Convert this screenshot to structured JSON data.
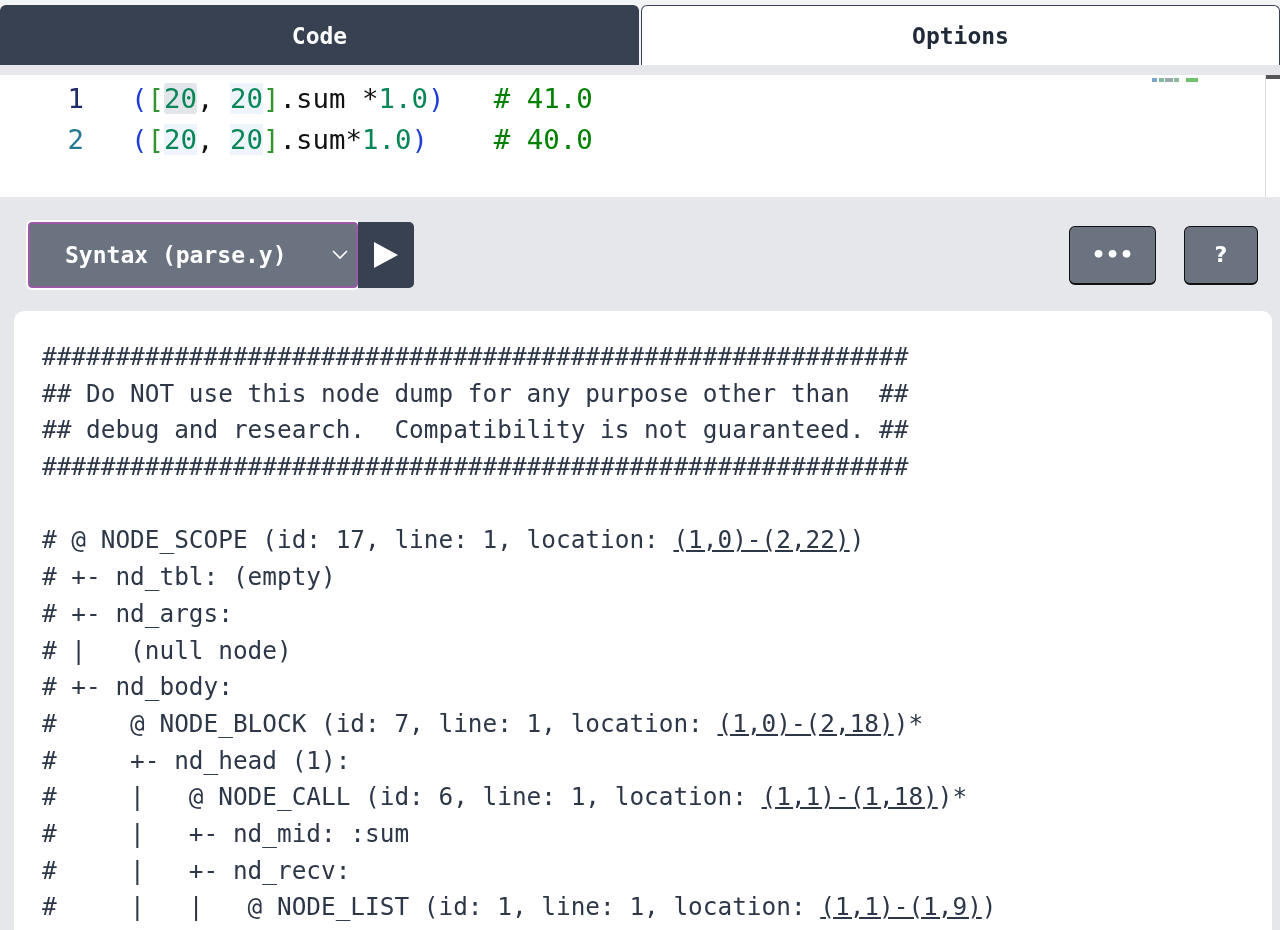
{
  "tabs": [
    {
      "label": "Code",
      "selected": true
    },
    {
      "label": "Options",
      "selected": false
    }
  ],
  "editor": {
    "lines": [
      {
        "number": "1",
        "current": true,
        "tokens": [
          {
            "text": "(",
            "kind": "paren"
          },
          {
            "text": "[",
            "kind": "bracket"
          },
          {
            "text": "20",
            "kind": "number",
            "highlighted": true,
            "selected": true
          },
          {
            "text": ", ",
            "kind": "plain"
          },
          {
            "text": "20",
            "kind": "number",
            "highlighted": true,
            "selected": false
          },
          {
            "text": "]",
            "kind": "bracket"
          },
          {
            "text": ".sum *",
            "kind": "plain"
          },
          {
            "text": "1.0",
            "kind": "number"
          },
          {
            "text": ")",
            "kind": "paren"
          },
          {
            "text": "# 41.0",
            "kind": "comment"
          }
        ]
      },
      {
        "number": "2",
        "current": false,
        "tokens": [
          {
            "text": "(",
            "kind": "paren"
          },
          {
            "text": "[",
            "kind": "bracket"
          },
          {
            "text": "20",
            "kind": "number",
            "highlighted": true,
            "selected": false
          },
          {
            "text": ", ",
            "kind": "plain"
          },
          {
            "text": "20",
            "kind": "number",
            "highlighted": true,
            "selected": false
          },
          {
            "text": "]",
            "kind": "bracket"
          },
          {
            "text": ".sum*",
            "kind": "plain"
          },
          {
            "text": "1.0",
            "kind": "number"
          },
          {
            "text": ")",
            "kind": "paren"
          },
          {
            "text": "# 40.0",
            "kind": "comment"
          }
        ]
      }
    ]
  },
  "toolbar": {
    "dropdown": {
      "value": "Syntax (parse.y)"
    },
    "buttons": [
      {
        "label": "•••"
      },
      {
        "label": "?"
      }
    ]
  },
  "output": {
    "sections": [
      {
        "lines": [
          {
            "text": "###########################################################"
          },
          {
            "text": "## Do NOT use this node dump for any purpose other than  ##"
          },
          {
            "text": "## debug and research.  Compatibility is not guaranteed. ##"
          },
          {
            "text": "###########################################################"
          }
        ]
      },
      {
        "lines": [
          {
            "text": "# @ NODE_SCOPE (id: 17, line: 1, location: ",
            "link": "(1,0)-(2,22)",
            "suffix": ")"
          },
          {
            "text": "# +- nd_tbl: (empty)"
          },
          {
            "text": "# +- nd_args:"
          },
          {
            "text": "# |   (null node)"
          },
          {
            "text": "# +- nd_body:"
          },
          {
            "text": "#     @ NODE_BLOCK (id: 7, line: 1, location: ",
            "link": "(1,0)-(2,18)",
            "suffix": ")*"
          },
          {
            "text": "#     +- nd_head (1):"
          },
          {
            "text": "#     |   @ NODE_CALL (id: 6, line: 1, location: ",
            "link": "(1,1)-(1,18)",
            "suffix": ")*"
          },
          {
            "text": "#     |   +- nd_mid: :sum"
          },
          {
            "text": "#     |   +- nd_recv:"
          },
          {
            "text": "#     |   |   @ NODE_LIST (id: 1, line: 1, location: ",
            "link": "(1,1)-(1,9)",
            "suffix": ")"
          }
        ]
      }
    ]
  }
}
